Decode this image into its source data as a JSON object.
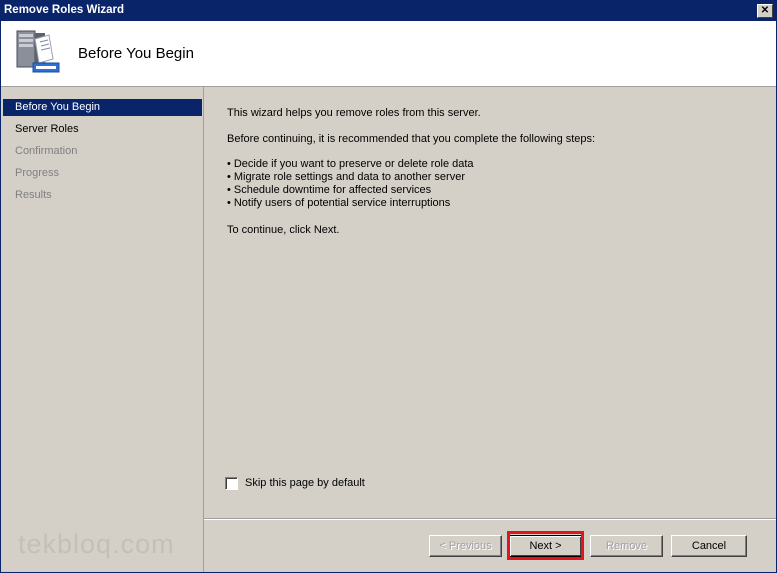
{
  "window": {
    "title": "Remove Roles Wizard",
    "close_glyph": "✕"
  },
  "header": {
    "title": "Before You Begin",
    "icon": "server-roles-icon"
  },
  "sidebar": {
    "items": [
      {
        "label": "Before You Begin",
        "state": "active"
      },
      {
        "label": "Server Roles",
        "state": "enabled"
      },
      {
        "label": "Confirmation",
        "state": "disabled"
      },
      {
        "label": "Progress",
        "state": "disabled"
      },
      {
        "label": "Results",
        "state": "disabled"
      }
    ]
  },
  "content": {
    "intro": "This wizard helps you remove roles from this server.",
    "before": "Before continuing, it is recommended that you complete the following steps:",
    "steps": [
      "Decide if you want to preserve or delete role data",
      "Migrate role settings and data to another server",
      "Schedule downtime for affected services",
      "Notify users of potential service interruptions"
    ],
    "continue": "To continue, click Next.",
    "skip_label": "Skip this page by default",
    "skip_checked": false
  },
  "buttons": {
    "previous": "< Previous",
    "next": "Next >",
    "remove": "Remove",
    "cancel": "Cancel"
  },
  "watermark": "tekbloq.com",
  "colors": {
    "titlebar": "#0a246a",
    "highlight": "#e0161c",
    "face": "#d4d0c8"
  }
}
